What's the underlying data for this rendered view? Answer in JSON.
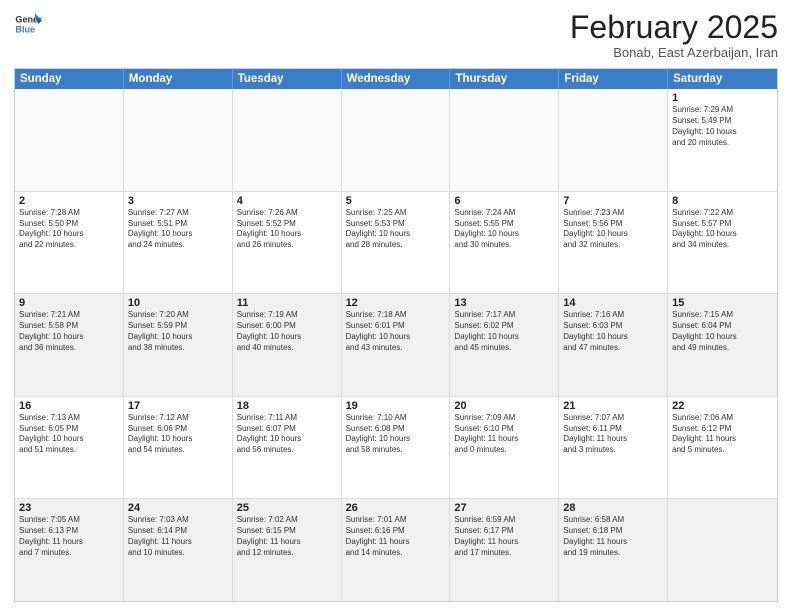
{
  "header": {
    "logo_general": "General",
    "logo_blue": "Blue",
    "month_title": "February 2025",
    "location": "Bonab, East Azerbaijan, Iran"
  },
  "weekdays": [
    "Sunday",
    "Monday",
    "Tuesday",
    "Wednesday",
    "Thursday",
    "Friday",
    "Saturday"
  ],
  "rows": [
    [
      {
        "day": "",
        "info": "",
        "empty": true
      },
      {
        "day": "",
        "info": "",
        "empty": true
      },
      {
        "day": "",
        "info": "",
        "empty": true
      },
      {
        "day": "",
        "info": "",
        "empty": true
      },
      {
        "day": "",
        "info": "",
        "empty": true
      },
      {
        "day": "",
        "info": "",
        "empty": true
      },
      {
        "day": "1",
        "info": "Sunrise: 7:29 AM\nSunset: 5:49 PM\nDaylight: 10 hours\nand 20 minutes."
      }
    ],
    [
      {
        "day": "2",
        "info": "Sunrise: 7:28 AM\nSunset: 5:50 PM\nDaylight: 10 hours\nand 22 minutes."
      },
      {
        "day": "3",
        "info": "Sunrise: 7:27 AM\nSunset: 5:51 PM\nDaylight: 10 hours\nand 24 minutes."
      },
      {
        "day": "4",
        "info": "Sunrise: 7:26 AM\nSunset: 5:52 PM\nDaylight: 10 hours\nand 26 minutes."
      },
      {
        "day": "5",
        "info": "Sunrise: 7:25 AM\nSunset: 5:53 PM\nDaylight: 10 hours\nand 28 minutes."
      },
      {
        "day": "6",
        "info": "Sunrise: 7:24 AM\nSunset: 5:55 PM\nDaylight: 10 hours\nand 30 minutes."
      },
      {
        "day": "7",
        "info": "Sunrise: 7:23 AM\nSunset: 5:56 PM\nDaylight: 10 hours\nand 32 minutes."
      },
      {
        "day": "8",
        "info": "Sunrise: 7:22 AM\nSunset: 5:57 PM\nDaylight: 10 hours\nand 34 minutes."
      }
    ],
    [
      {
        "day": "9",
        "info": "Sunrise: 7:21 AM\nSunset: 5:58 PM\nDaylight: 10 hours\nand 36 minutes.",
        "shaded": true
      },
      {
        "day": "10",
        "info": "Sunrise: 7:20 AM\nSunset: 5:59 PM\nDaylight: 10 hours\nand 38 minutes.",
        "shaded": true
      },
      {
        "day": "11",
        "info": "Sunrise: 7:19 AM\nSunset: 6:00 PM\nDaylight: 10 hours\nand 40 minutes.",
        "shaded": true
      },
      {
        "day": "12",
        "info": "Sunrise: 7:18 AM\nSunset: 6:01 PM\nDaylight: 10 hours\nand 43 minutes.",
        "shaded": true
      },
      {
        "day": "13",
        "info": "Sunrise: 7:17 AM\nSunset: 6:02 PM\nDaylight: 10 hours\nand 45 minutes.",
        "shaded": true
      },
      {
        "day": "14",
        "info": "Sunrise: 7:16 AM\nSunset: 6:03 PM\nDaylight: 10 hours\nand 47 minutes.",
        "shaded": true
      },
      {
        "day": "15",
        "info": "Sunrise: 7:15 AM\nSunset: 6:04 PM\nDaylight: 10 hours\nand 49 minutes.",
        "shaded": true
      }
    ],
    [
      {
        "day": "16",
        "info": "Sunrise: 7:13 AM\nSunset: 6:05 PM\nDaylight: 10 hours\nand 51 minutes."
      },
      {
        "day": "17",
        "info": "Sunrise: 7:12 AM\nSunset: 6:06 PM\nDaylight: 10 hours\nand 54 minutes."
      },
      {
        "day": "18",
        "info": "Sunrise: 7:11 AM\nSunset: 6:07 PM\nDaylight: 10 hours\nand 56 minutes."
      },
      {
        "day": "19",
        "info": "Sunrise: 7:10 AM\nSunset: 6:08 PM\nDaylight: 10 hours\nand 58 minutes."
      },
      {
        "day": "20",
        "info": "Sunrise: 7:09 AM\nSunset: 6:10 PM\nDaylight: 11 hours\nand 0 minutes."
      },
      {
        "day": "21",
        "info": "Sunrise: 7:07 AM\nSunset: 6:11 PM\nDaylight: 11 hours\nand 3 minutes."
      },
      {
        "day": "22",
        "info": "Sunrise: 7:06 AM\nSunset: 6:12 PM\nDaylight: 11 hours\nand 5 minutes."
      }
    ],
    [
      {
        "day": "23",
        "info": "Sunrise: 7:05 AM\nSunset: 6:13 PM\nDaylight: 11 hours\nand 7 minutes.",
        "shaded": true
      },
      {
        "day": "24",
        "info": "Sunrise: 7:03 AM\nSunset: 6:14 PM\nDaylight: 11 hours\nand 10 minutes.",
        "shaded": true
      },
      {
        "day": "25",
        "info": "Sunrise: 7:02 AM\nSunset: 6:15 PM\nDaylight: 11 hours\nand 12 minutes.",
        "shaded": true
      },
      {
        "day": "26",
        "info": "Sunrise: 7:01 AM\nSunset: 6:16 PM\nDaylight: 11 hours\nand 14 minutes.",
        "shaded": true
      },
      {
        "day": "27",
        "info": "Sunrise: 6:59 AM\nSunset: 6:17 PM\nDaylight: 11 hours\nand 17 minutes.",
        "shaded": true
      },
      {
        "day": "28",
        "info": "Sunrise: 6:58 AM\nSunset: 6:18 PM\nDaylight: 11 hours\nand 19 minutes.",
        "shaded": true
      },
      {
        "day": "",
        "info": "",
        "empty": true,
        "shaded": true
      }
    ]
  ]
}
